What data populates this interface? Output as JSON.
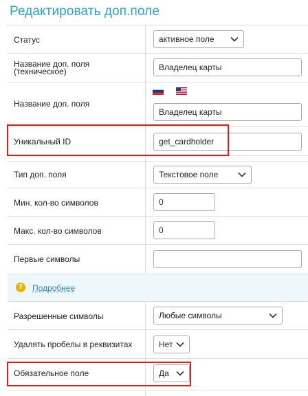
{
  "page_title": "Редактировать доп.поле",
  "rows": {
    "status": {
      "label": "Статус",
      "value": "активное поле"
    },
    "tech_name": {
      "label_line1": "Название доп. поля",
      "label_line2": "(техническое)",
      "value": "Владелец карты"
    },
    "display_name": {
      "label": "Название доп. поля",
      "value": "Владелец карты",
      "flags": [
        "ru-flag-icon",
        "us-flag-icon"
      ]
    },
    "unique_id": {
      "label": "Уникальный ID",
      "value": "get_cardholder"
    },
    "field_type": {
      "label": "Тип доп. поля",
      "value": "Текстовое поле"
    },
    "min_chars": {
      "label": "Мин. кол-во символов",
      "value": "0"
    },
    "max_chars": {
      "label": "Макс. кол-во символов",
      "value": "0"
    },
    "first_chars": {
      "label": "Первые символы",
      "value": ""
    },
    "more": {
      "link": "Подробнее",
      "icon": "question-icon"
    },
    "allowed_chars": {
      "label": "Разрешенные символы",
      "value": "Любые символы"
    },
    "strip_spaces": {
      "label": "Удалять пробелы в реквизитах",
      "value": "Нет"
    },
    "required": {
      "label": "Обязательное поле",
      "value": "Да"
    }
  },
  "colors": {
    "accent": "#2aa3c7",
    "highlight": "#e21b1b",
    "link": "#2a89c2",
    "info_bg": "#eef8fc"
  }
}
